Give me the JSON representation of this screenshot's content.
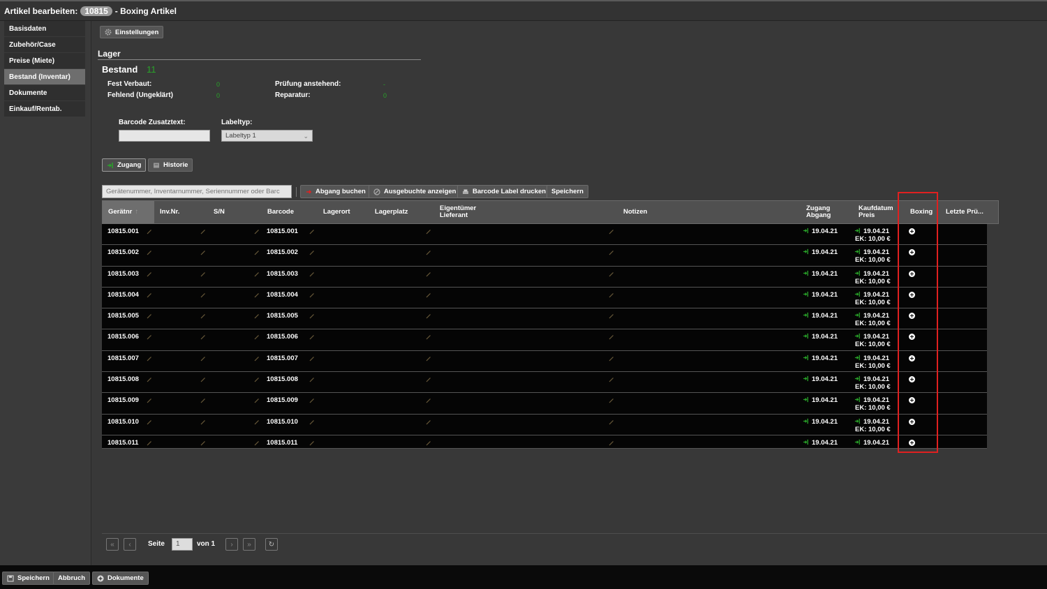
{
  "window": {
    "title_prefix": "Artikel bearbeiten:",
    "article_id": "10815",
    "title_suffix": "- Boxing Artikel"
  },
  "sidebar": {
    "items": [
      {
        "label": "Basisdaten",
        "active": false
      },
      {
        "label": "Zubehör/Case",
        "active": false
      },
      {
        "label": "Preise (Miete)",
        "active": false
      },
      {
        "label": "Bestand (Inventar)",
        "active": true
      },
      {
        "label": "Dokumente",
        "active": false
      },
      {
        "label": "Einkauf/Rentab.",
        "active": false
      }
    ]
  },
  "toolbar": {
    "settings_label": "Einstellungen"
  },
  "lager": {
    "section_title": "Lager",
    "bestand_label": "Bestand",
    "bestand_value": "11",
    "fest_verbaut_label": "Fest Verbaut:",
    "fest_verbaut_value": "0",
    "fehlend_label": "Fehlend (Ungeklärt)",
    "fehlend_value": "0",
    "pruefung_label": "Prüfung anstehend:",
    "pruefung_value": "-",
    "reparatur_label": "Reparatur:",
    "reparatur_value": "0"
  },
  "barcode": {
    "zusatztext_label": "Barcode Zusatztext:",
    "zusatztext_value": "",
    "labeltyp_label": "Labeltyp:",
    "labeltyp_value": "Labeltyp 1"
  },
  "tabs": {
    "zugang": "Zugang",
    "historie": "Historie"
  },
  "actions": {
    "search_placeholder": "Gerätenummer, Inventarnummer, Seriennummer oder Barc",
    "abgang": "Abgang buchen",
    "ausgebuchte": "Ausgebuchte anzeigen",
    "barcode_label": "Barcode Label drucken",
    "speichern": "Speichern"
  },
  "table": {
    "headers": {
      "geraetnr": "Gerätnr",
      "invnr": "Inv.Nr.",
      "sn": "S/N",
      "barcode": "Barcode",
      "lagerort": "Lagerort",
      "lagerplatz": "Lagerplatz",
      "eigentuemer_1": "Eigentümer",
      "eigentuemer_2": "Lieferant",
      "notizen": "Notizen",
      "zugang_1": "Zugang",
      "zugang_2": "Abgang",
      "kaufdatum_1": "Kaufdatum",
      "kaufdatum_2": "Preis",
      "boxing": "Boxing",
      "letzte": "Letzte Prü..."
    },
    "rows": [
      {
        "geraetnr": "10815.001",
        "barcode": "10815.001",
        "zugang": "19.04.21",
        "kaufdatum": "19.04.21",
        "preis": "EK: 10,00 €"
      },
      {
        "geraetnr": "10815.002",
        "barcode": "10815.002",
        "zugang": "19.04.21",
        "kaufdatum": "19.04.21",
        "preis": "EK: 10,00 €"
      },
      {
        "geraetnr": "10815.003",
        "barcode": "10815.003",
        "zugang": "19.04.21",
        "kaufdatum": "19.04.21",
        "preis": "EK: 10,00 €"
      },
      {
        "geraetnr": "10815.004",
        "barcode": "10815.004",
        "zugang": "19.04.21",
        "kaufdatum": "19.04.21",
        "preis": "EK: 10,00 €"
      },
      {
        "geraetnr": "10815.005",
        "barcode": "10815.005",
        "zugang": "19.04.21",
        "kaufdatum": "19.04.21",
        "preis": "EK: 10,00 €"
      },
      {
        "geraetnr": "10815.006",
        "barcode": "10815.006",
        "zugang": "19.04.21",
        "kaufdatum": "19.04.21",
        "preis": "EK: 10,00 €"
      },
      {
        "geraetnr": "10815.007",
        "barcode": "10815.007",
        "zugang": "19.04.21",
        "kaufdatum": "19.04.21",
        "preis": "EK: 10,00 €"
      },
      {
        "geraetnr": "10815.008",
        "barcode": "10815.008",
        "zugang": "19.04.21",
        "kaufdatum": "19.04.21",
        "preis": "EK: 10,00 €"
      },
      {
        "geraetnr": "10815.009",
        "barcode": "10815.009",
        "zugang": "19.04.21",
        "kaufdatum": "19.04.21",
        "preis": "EK: 10,00 €"
      },
      {
        "geraetnr": "10815.010",
        "barcode": "10815.010",
        "zugang": "19.04.21",
        "kaufdatum": "19.04.21",
        "preis": "EK: 10,00 €"
      },
      {
        "geraetnr": "10815.011",
        "barcode": "10815.011",
        "zugang": "19.04.21",
        "kaufdatum": "19.04.21",
        "preis": ""
      }
    ]
  },
  "pager": {
    "seite_label": "Seite",
    "page_value": "1",
    "von_label": "von 1"
  },
  "footer": {
    "speichern": "Speichern",
    "abbruch": "Abbruch",
    "dokumente": "Dokumente"
  },
  "colors": {
    "accent_green": "#29a329",
    "highlight_red": "#e02020",
    "row_bg": "#050505"
  }
}
